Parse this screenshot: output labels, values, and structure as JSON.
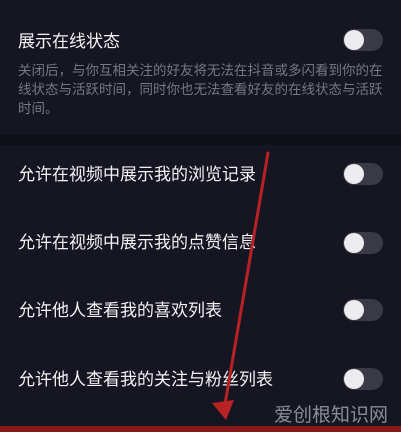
{
  "settings": {
    "online_status": {
      "label": "展示在线状态",
      "description": "关闭后，与你互相关注的好友将无法在抖音或多闪看到你的在线状态与活跃时间，同时你也无法查看好友的在线状态与活跃时间。",
      "enabled": false
    },
    "items": [
      {
        "label": "允许在视频中展示我的浏览记录",
        "enabled": false
      },
      {
        "label": "允许在视频中展示我的点赞信息",
        "enabled": false
      },
      {
        "label": "允许他人查看我的喜欢列表",
        "enabled": false
      },
      {
        "label": "允许他人查看我的关注与粉丝列表",
        "enabled": false
      }
    ]
  },
  "watermark": "爱创根知识网",
  "colors": {
    "background": "#161622",
    "toggle_off": "#3a3a46",
    "annotation_arrow": "#c0282a"
  }
}
